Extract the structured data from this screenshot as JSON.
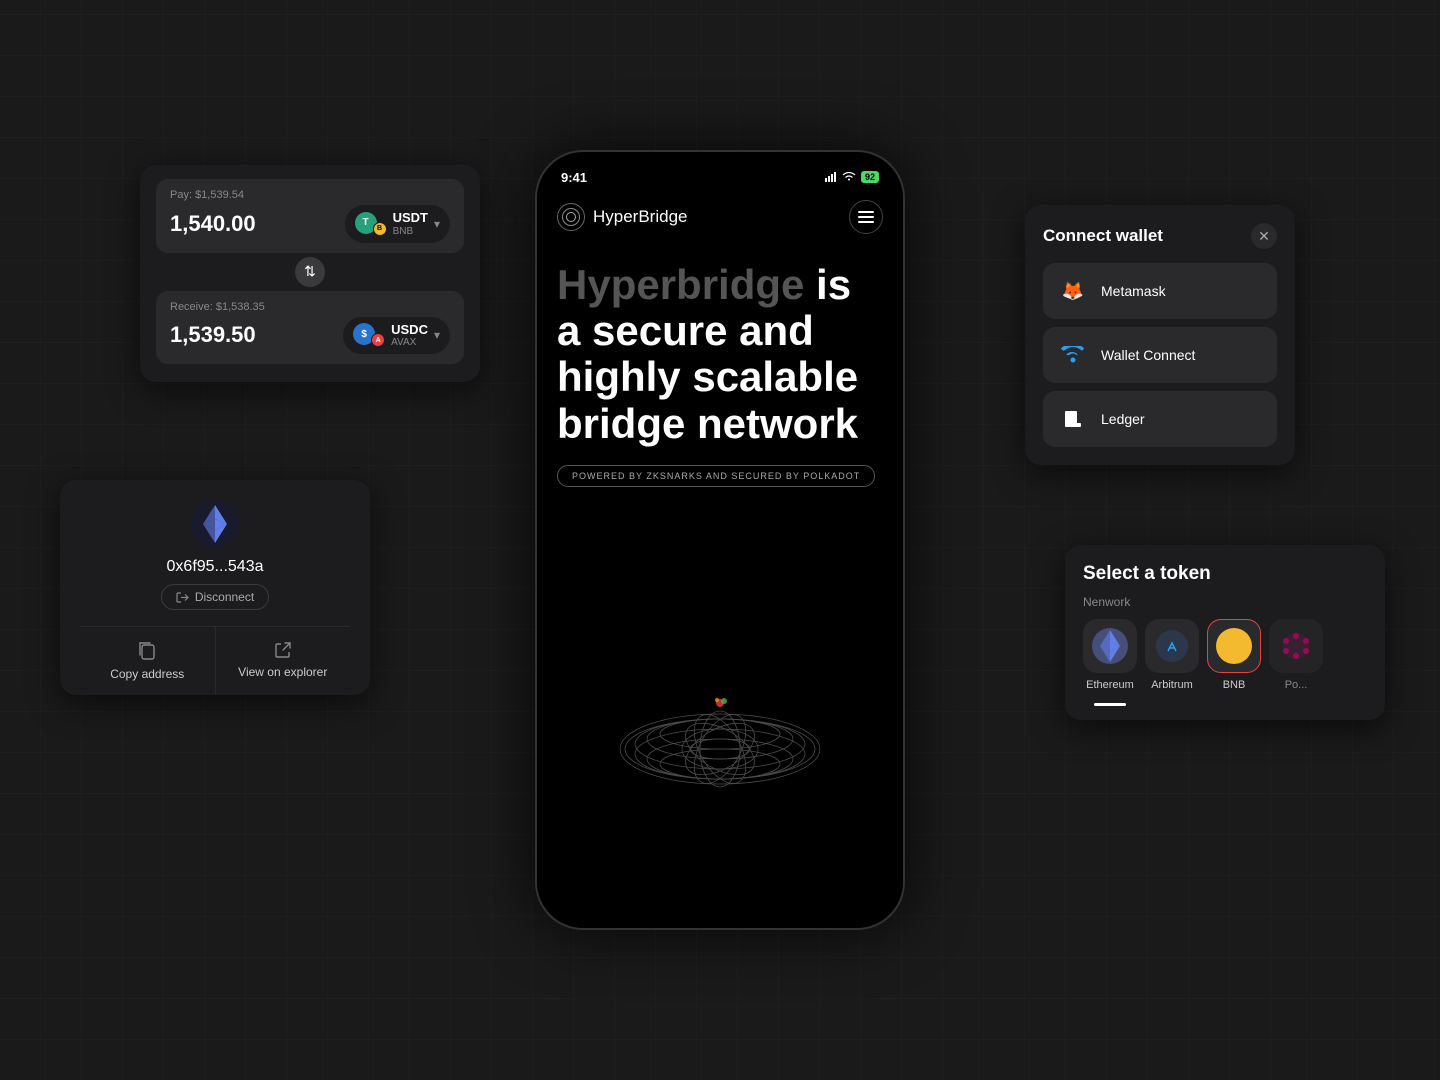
{
  "app": {
    "title": "HyperBridge",
    "status_time": "9:41",
    "battery": "92"
  },
  "hero": {
    "line1_accent": "Hyperbridge",
    "line1_rest": " is",
    "line2": "a secure and",
    "line3": "highly scalable",
    "line4": "bridge network",
    "badge": "POWERED BY ZKSNARKS AND SECURED BY POLKADOT"
  },
  "swap_card": {
    "pay_label": "Pay: $1,539.54",
    "pay_amount": "1,540.00",
    "pay_token_main": "USDT",
    "pay_token_secondary": "BNB",
    "receive_label": "Receive: $1,538.35",
    "receive_amount": "1,539.50",
    "receive_token_main": "USDC",
    "receive_token_secondary": "AVAX"
  },
  "wallet_card": {
    "address": "0x6f95...543a",
    "disconnect_label": "Disconnect",
    "copy_label": "Copy address",
    "explorer_label": "View on explorer"
  },
  "connect_wallet": {
    "title": "Connect wallet",
    "options": [
      {
        "name": "Metamask",
        "icon": "🦊"
      },
      {
        "name": "Wallet Connect",
        "icon": "🔗"
      },
      {
        "name": "Ledger",
        "icon": "📱"
      }
    ]
  },
  "select_token": {
    "title": "Select a token",
    "network_label": "Nenwork",
    "networks": [
      {
        "name": "Ethereum",
        "selected": false
      },
      {
        "name": "Arbitrum",
        "selected": false
      },
      {
        "name": "BNB",
        "selected": true
      },
      {
        "name": "Po...",
        "selected": false
      }
    ]
  }
}
